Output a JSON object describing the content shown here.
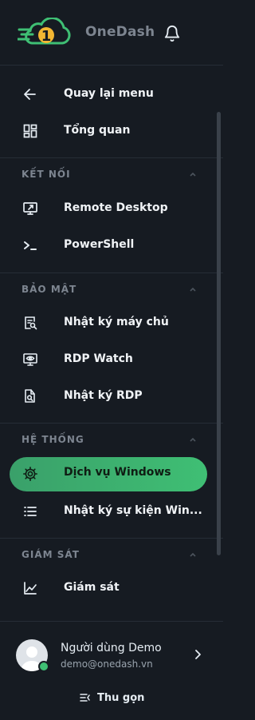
{
  "app": {
    "brand": "OneDash",
    "logo_digit": "1"
  },
  "nav": {
    "items": [
      {
        "label": "Quay lại menu",
        "icon": "arrow-left-icon"
      },
      {
        "label": "Tổng quan",
        "icon": "dashboard-grid-icon"
      }
    ],
    "sections": [
      {
        "title": "KẾT NỐI",
        "items": [
          {
            "label": "Remote Desktop",
            "icon": "remote-desktop-icon"
          },
          {
            "label": "PowerShell",
            "icon": "terminal-icon"
          }
        ]
      },
      {
        "title": "BẢO MẬT",
        "items": [
          {
            "label": "Nhật ký máy chủ",
            "icon": "log-search-icon"
          },
          {
            "label": "RDP Watch",
            "icon": "monitor-eye-icon"
          },
          {
            "label": "Nhật ký RDP",
            "icon": "file-search-icon"
          }
        ]
      },
      {
        "title": "HỆ THỐNG",
        "items": [
          {
            "label": "Dịch vụ Windows",
            "icon": "gear-icon",
            "active": true
          },
          {
            "label": "Nhật ký sự kiện Win...",
            "icon": "list-icon"
          }
        ]
      },
      {
        "title": "GIÁM SÁT",
        "items": [
          {
            "label": "Giám sát",
            "icon": "chart-line-icon"
          }
        ]
      }
    ]
  },
  "user": {
    "name": "Người dùng Demo",
    "email": "demo@onedash.vn",
    "status": "online"
  },
  "footer": {
    "collapse_label": "Thu gọn"
  },
  "colors": {
    "accent": "#3fbf74",
    "background": "#161b22",
    "muted": "#7d8590"
  }
}
